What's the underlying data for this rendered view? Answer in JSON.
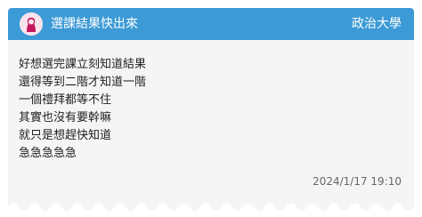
{
  "card": {
    "title": "選課結果快出來",
    "board": "政治大學",
    "body_lines": [
      "好想選完課立刻知道結果",
      "還得等到二階才知道一階",
      "一個禮拜都等不住",
      "其實也沒有要幹嘛",
      "就只是想趕快知道",
      "急急急急急"
    ],
    "timestamp": "2024/1/17 19:10"
  },
  "icons": {
    "avatar": "female-avatar-icon"
  },
  "colors": {
    "header": "#3c9ad6",
    "card_background": "#f5f5f5",
    "avatar_background": "#fbe3ec",
    "avatar_figure": "#c2185b"
  }
}
